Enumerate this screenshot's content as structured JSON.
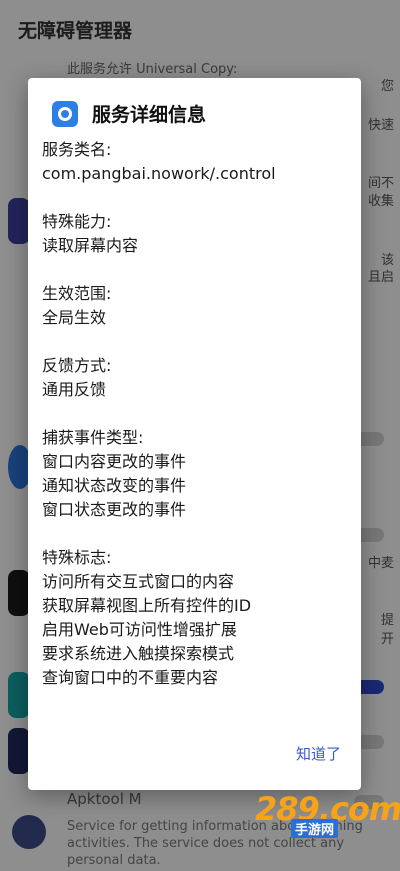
{
  "app": {
    "title": "无障碍管理器",
    "bg_line_top": "此服务允许 Universal Copy:",
    "side_texts": [
      "您",
      "快速",
      "间不",
      "收集",
      "该",
      "且启",
      "中麦",
      "提",
      "开"
    ],
    "apktool_title": "Apktool M",
    "apktool_desc": "Service for getting information about running activities. The service does not collect any personal data."
  },
  "dialog": {
    "title": "服务详细信息",
    "sections": [
      {
        "label": "服务类名:",
        "lines": [
          "com.pangbai.nowork/.control"
        ]
      },
      {
        "label": "特殊能力:",
        "lines": [
          "读取屏幕内容"
        ]
      },
      {
        "label": "生效范围:",
        "lines": [
          "全局生效"
        ]
      },
      {
        "label": "反馈方式:",
        "lines": [
          "通用反馈"
        ]
      },
      {
        "label": "捕获事件类型:",
        "lines": [
          "窗口内容更改的事件",
          "通知状态改变的事件",
          "窗口状态更改的事件"
        ]
      },
      {
        "label": "特殊标志:",
        "lines": [
          "访问所有交互式窗口的内容",
          "获取屏幕视图上所有控件的ID",
          "启用Web可访问性增强扩展",
          "要求系统进入触摸探索模式",
          "查询窗口中的不重要内容"
        ]
      }
    ],
    "confirm_label": "知道了",
    "icon": "accessibility-service-icon"
  },
  "watermark": {
    "big": "289.com",
    "small": "手游网"
  },
  "colors": {
    "accent": "#3a59c8",
    "toggle_on": "#2e45c9",
    "scrim": "rgba(0,0,0,0.42)"
  }
}
